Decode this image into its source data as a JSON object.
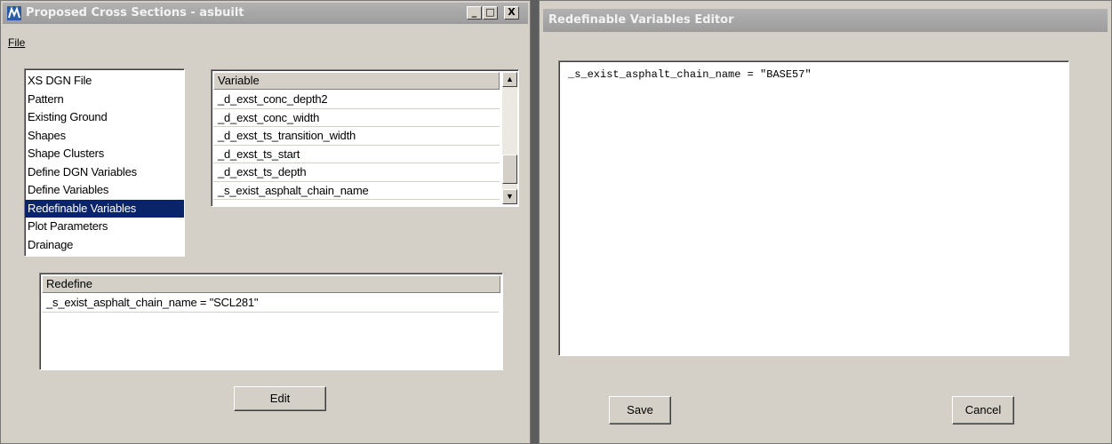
{
  "left_window": {
    "title": "Proposed Cross Sections - asbuilt",
    "controls": [
      "_",
      "□",
      "X"
    ],
    "menu": {
      "file": "File"
    },
    "categories": [
      {
        "label": "XS DGN File",
        "selected": false
      },
      {
        "label": "Pattern",
        "selected": false
      },
      {
        "label": "Existing Ground",
        "selected": false
      },
      {
        "label": "Shapes",
        "selected": false
      },
      {
        "label": "Shape Clusters",
        "selected": false
      },
      {
        "label": "Define DGN Variables",
        "selected": false
      },
      {
        "label": "Define Variables",
        "selected": false
      },
      {
        "label": "Redefinable Variables",
        "selected": true
      },
      {
        "label": "Plot Parameters",
        "selected": false
      },
      {
        "label": "Drainage",
        "selected": false
      }
    ],
    "variable_list": {
      "header": "Variable",
      "rows": [
        "_d_exst_conc_depth2",
        "_d_exst_conc_width",
        "_d_exst_ts_transition_width",
        "_d_exst_ts_start",
        "_d_exst_ts_depth",
        "_s_exist_asphalt_chain_name"
      ]
    },
    "redefine_list": {
      "header": "Redefine",
      "rows": [
        "_s_exist_asphalt_chain_name = \"SCL281\""
      ]
    },
    "edit_button": "Edit"
  },
  "right_window": {
    "title": "Redefinable Variables Editor",
    "editor_text": "_s_exist_asphalt_chain_name = \"BASE57\"",
    "save_button": "Save",
    "cancel_button": "Cancel"
  },
  "colors": {
    "selection": "#0a246a",
    "titlebar_inactive": "#a6a6a6",
    "face": "#d4d0c8"
  },
  "icons": [
    "app-icon",
    "minimize-icon",
    "maximize-icon",
    "close-icon",
    "scroll-up-arrow-icon",
    "scroll-down-arrow-icon"
  ]
}
